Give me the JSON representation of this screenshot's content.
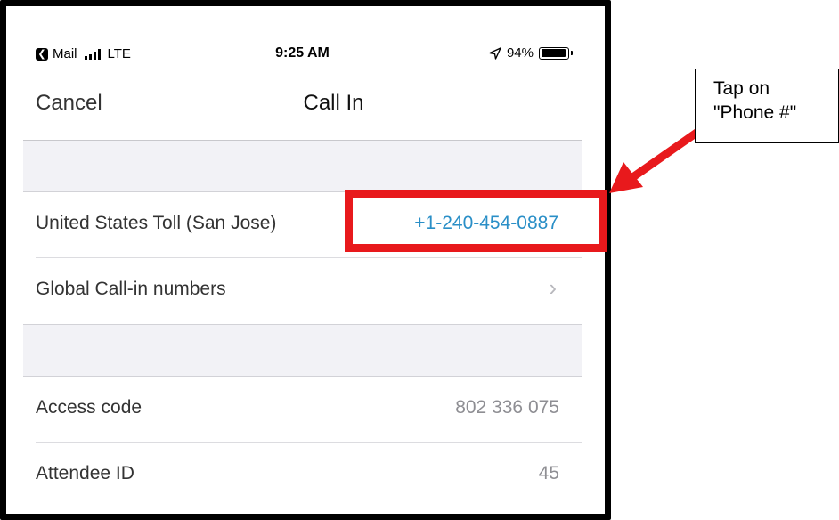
{
  "status_bar": {
    "back_app": "Mail",
    "carrier": "LTE",
    "time": "9:25 AM",
    "battery": "94%",
    "battery_level": 0.94
  },
  "nav": {
    "cancel_label": "Cancel",
    "title": "Call In"
  },
  "rows": [
    {
      "label": "United States Toll (San Jose)",
      "value": "+1-240-454-0887"
    },
    {
      "label": "Global Call-in numbers",
      "value": ""
    },
    {
      "label": "Access code",
      "value": "802 336 075"
    },
    {
      "label": "Attendee ID",
      "value": "45"
    }
  ],
  "annotation": {
    "callout_text": "Tap on\n\"Phone #\"",
    "highlight_color": "#e8191c"
  },
  "colors": {
    "link": "#2a8fc7",
    "group_background": "#f2f2f6"
  },
  "icons": {
    "back": "back-icon",
    "signal": "signal-icon",
    "location": "location-arrow-icon",
    "battery": "battery-icon",
    "chevron": "chevron-right-icon",
    "arrow": "red-arrow-icon"
  }
}
